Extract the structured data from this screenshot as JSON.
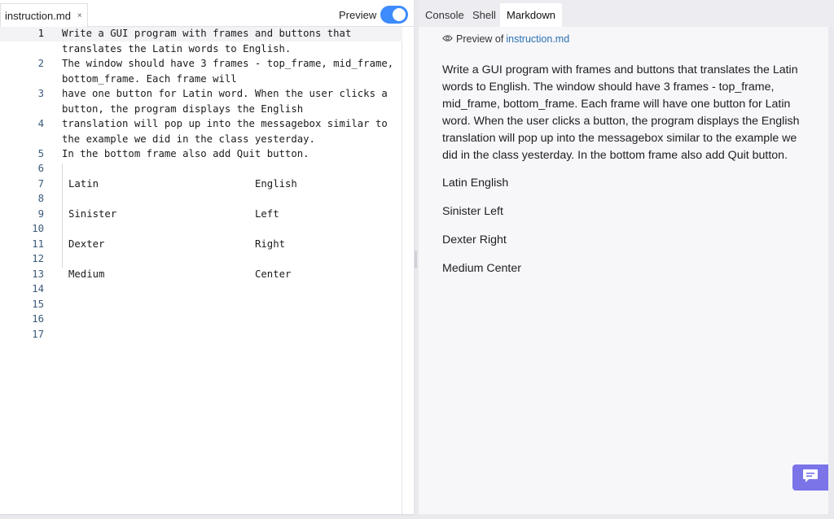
{
  "editor": {
    "file_tab": "instruction.md",
    "close_glyph": "×",
    "preview_label": "Preview",
    "preview_enabled": true,
    "line_numbers": [
      "1",
      "2",
      "3",
      "4",
      "5",
      "6",
      "7",
      "8",
      "9",
      "10",
      "11",
      "12",
      "13",
      "14",
      "15",
      "16",
      "17"
    ],
    "code": {
      "l1a": "Write a GUI program with frames and buttons that",
      "l1b": "translates the Latin words to English.",
      "l2a": "The window should have 3 frames - top_frame, mid_frame,",
      "l2b": "bottom_frame. Each frame will",
      "l3a": "have one button for Latin word. When the user clicks a",
      "l3b": "button, the program displays the English",
      "l4a": "translation will pop up into the messagebox similar to",
      "l4b": "the example we did in the class yesterday.",
      "l5": "In the bottom frame also add Quit button."
    },
    "table": [
      {
        "latin": "Latin",
        "english": "English"
      },
      {
        "latin": "Sinister",
        "english": "Left"
      },
      {
        "latin": "Dexter",
        "english": "Right"
      },
      {
        "latin": "Medium",
        "english": "Center"
      }
    ]
  },
  "right_tabs": [
    "Console",
    "Shell",
    "Markdown"
  ],
  "active_right_tab": "Markdown",
  "preview": {
    "preview_of_label": "Preview of",
    "preview_of_file": "instruction.md",
    "paragraph": "Write a GUI program with frames and buttons that translates the Latin words to English. The window should have 3 frames - top_frame, mid_frame, bottom_frame. Each frame will have one button for Latin word. When the user clicks a button, the program displays the English translation will pop up into the messagebox similar to the example we did in the class yesterday. In the bottom frame also add Quit button.",
    "rows": [
      "Latin English",
      "Sinister Left",
      "Dexter Right",
      "Medium Center"
    ]
  },
  "colors": {
    "accent": "#3d8bfd",
    "link": "#2a6fb0",
    "chat_button": "#7b73e8"
  },
  "icons": {
    "preview_eye": "eye-icon",
    "chat": "chat-icon"
  }
}
